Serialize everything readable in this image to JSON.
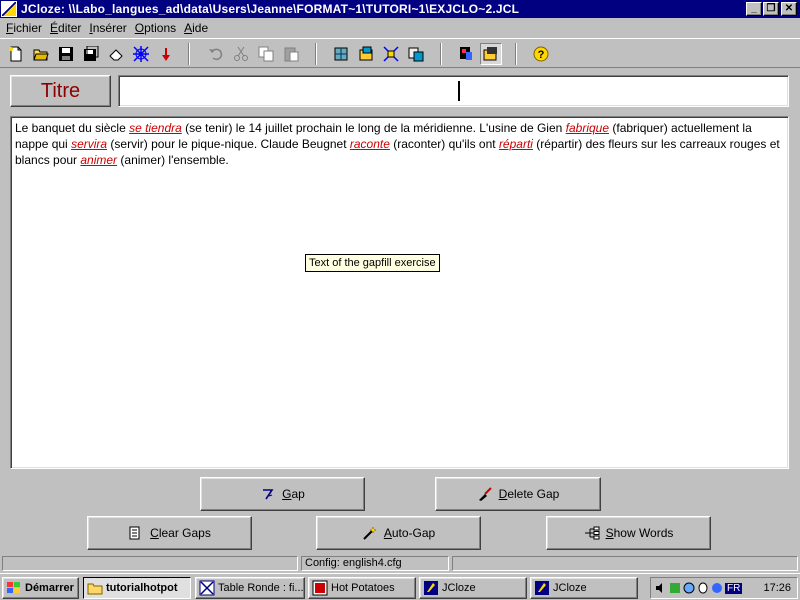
{
  "window": {
    "title": "JCloze: \\\\Labo_langues_ad\\data\\Users\\Jeanne\\FORMAT~1\\TUTORI~1\\EXJCLO~2.JCL",
    "icon": "jcloze-app-icon"
  },
  "menu": [
    {
      "label": "Fichier",
      "accel": "F"
    },
    {
      "label": "Éditer",
      "accel": "É"
    },
    {
      "label": "Insérer",
      "accel": "I"
    },
    {
      "label": "Options",
      "accel": "O"
    },
    {
      "label": "Aide",
      "accel": "A"
    }
  ],
  "toolbar_icons": [
    "new-file-icon",
    "open-folder-icon",
    "save-icon",
    "save-as-icon",
    "eraser-icon",
    "web-icon",
    "pin-icon",
    "undo-icon",
    "cut-icon",
    "copy-icon",
    "paste-icon",
    "export-icon-1",
    "export-icon-2",
    "export-icon-3",
    "export-icon-4",
    "image-icon",
    "image-pressed-icon",
    "help-icon"
  ],
  "title_field": {
    "label": "Titre",
    "value": ""
  },
  "exercise": {
    "segments": [
      {
        "text": "Le banquet du siècle ",
        "gap": false
      },
      {
        "text": "se tiendra",
        "gap": true
      },
      {
        "text": " (se tenir) le 14 juillet prochain le long de la méridienne. L'usine de Gien ",
        "gap": false
      },
      {
        "text": "fabrique",
        "gap": true
      },
      {
        "text": " (fabriquer) actuellement la nappe qui ",
        "gap": false
      },
      {
        "text": "servira",
        "gap": true
      },
      {
        "text": " (servir) pour le pique-nique. Claude Beugnet ",
        "gap": false
      },
      {
        "text": "raconte",
        "gap": true
      },
      {
        "text": " (raconter) qu'ils ont ",
        "gap": false
      },
      {
        "text": "réparti",
        "gap": true
      },
      {
        "text": " (répartir) des fleurs sur les carreaux rouges et blancs pour ",
        "gap": false
      },
      {
        "text": "animer",
        "gap": true
      },
      {
        "text": " (animer) l'ensemble.",
        "gap": false
      }
    ],
    "gap_color": "#cc0000"
  },
  "tooltip": "Text of the gapfill exercise",
  "buttons": {
    "gap": "Gap",
    "delete_gap": "Delete Gap",
    "clear_gaps": "Clear Gaps",
    "auto_gap": "Auto-Gap",
    "show_words": "Show Words"
  },
  "status": {
    "config": "Config: english4.cfg"
  },
  "taskbar": {
    "start": "Démarrer",
    "tasks": [
      "tutorialhotpot",
      "Table Ronde : fi...",
      "Hot Potatoes",
      "JCloze",
      "JCloze"
    ],
    "lang": "FR",
    "clock": "17:26"
  },
  "colors": {
    "title_bar": "#000080",
    "face": "#c0c0c0",
    "titre_label": "#8b0000"
  }
}
